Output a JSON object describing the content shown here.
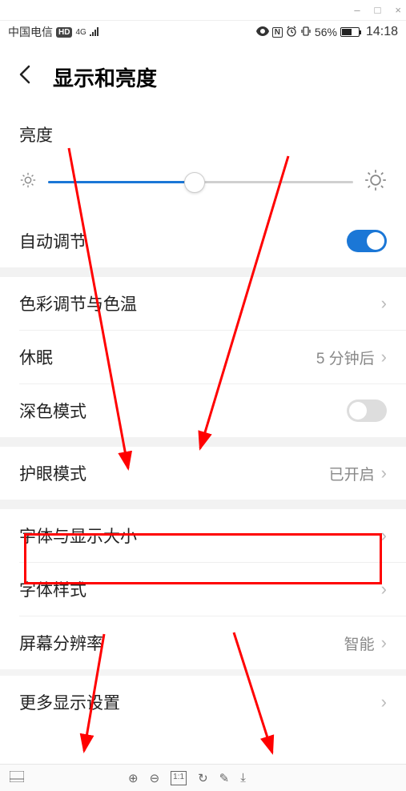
{
  "window_controls": {
    "minimize": "–",
    "maximize": "□",
    "close": "×"
  },
  "status_bar": {
    "carrier": "中国电信",
    "hd_badge": "HD",
    "network_type": "4G",
    "battery_text": "56%",
    "time": "14:18"
  },
  "header": {
    "title": "显示和亮度"
  },
  "brightness": {
    "label": "亮度",
    "slider_percent": 48
  },
  "rows": {
    "auto_adjust": {
      "label": "自动调节",
      "toggle": true
    },
    "color_temp": {
      "label": "色彩调节与色温"
    },
    "sleep": {
      "label": "休眠",
      "value": "5 分钟后"
    },
    "dark_mode": {
      "label": "深色模式",
      "toggle": false
    },
    "eye_comfort": {
      "label": "护眼模式",
      "value": "已开启"
    },
    "font_size": {
      "label": "字体与显示大小"
    },
    "font_style": {
      "label": "字体样式"
    },
    "resolution": {
      "label": "屏幕分辨率",
      "value": "智能"
    },
    "more": {
      "label": "更多显示设置"
    }
  },
  "footer_icons": {
    "zoom_in": "⊕",
    "zoom_out": "⊖",
    "fit": "1:1",
    "rotate": "↻",
    "edit": "✎",
    "download": "⤓"
  }
}
